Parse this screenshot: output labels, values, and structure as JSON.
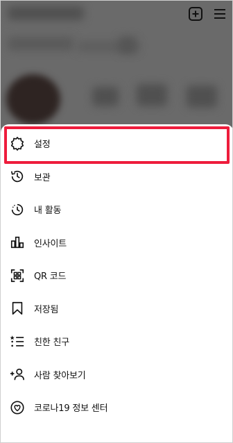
{
  "menu": {
    "items": [
      {
        "label": "설정",
        "icon": "settings-icon"
      },
      {
        "label": "보관",
        "icon": "archive-icon"
      },
      {
        "label": "내 활동",
        "icon": "activity-icon"
      },
      {
        "label": "인사이트",
        "icon": "insights-icon"
      },
      {
        "label": "QR 코드",
        "icon": "qr-code-icon"
      },
      {
        "label": "저장됨",
        "icon": "bookmark-icon"
      },
      {
        "label": "친한 친구",
        "icon": "close-friends-icon"
      },
      {
        "label": "사람 찾아보기",
        "icon": "discover-people-icon"
      },
      {
        "label": "코로나19 정보 센터",
        "icon": "covid-info-icon"
      }
    ]
  },
  "colors": {
    "highlight": "#ee1c3c",
    "backdrop": "#6a6a6a"
  }
}
